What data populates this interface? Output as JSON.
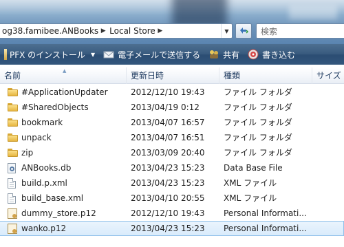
{
  "address": {
    "crumbs": [
      "og38.famibee.ANBooks",
      "Local Store"
    ],
    "separator": "▶",
    "dropdown_glyph": "▼"
  },
  "search": {
    "placeholder": "検索"
  },
  "toolbar": {
    "install_label": "PFX のインストール",
    "email_label": "電子メールで送信する",
    "share_label": "共有",
    "burn_label": "書き込む",
    "caret": "▼"
  },
  "columns": {
    "name": "名前",
    "date": "更新日時",
    "type": "種類",
    "size": "サイズ",
    "sort_glyph": "▲"
  },
  "files": [
    {
      "icon": "folder-icon",
      "name": "#ApplicationUpdater",
      "date": "2012/12/10 19:43",
      "type": "ファイル フォルダ"
    },
    {
      "icon": "folder-icon",
      "name": "#SharedObjects",
      "date": "2013/04/19 0:12",
      "type": "ファイル フォルダ"
    },
    {
      "icon": "folder-icon",
      "name": "bookmark",
      "date": "2013/04/07 16:57",
      "type": "ファイル フォルダ"
    },
    {
      "icon": "folder-icon",
      "name": "unpack",
      "date": "2013/04/07 16:51",
      "type": "ファイル フォルダ"
    },
    {
      "icon": "folder-icon",
      "name": "zip",
      "date": "2013/03/09 20:40",
      "type": "ファイル フォルダ"
    },
    {
      "icon": "database-file-icon",
      "name": "ANBooks.db",
      "date": "2013/04/23 15:23",
      "type": "Data Base File"
    },
    {
      "icon": "xml-file-icon",
      "name": "build.p.xml",
      "date": "2013/04/23 15:23",
      "type": "XML ファイル"
    },
    {
      "icon": "xml-file-icon",
      "name": "build_base.xml",
      "date": "2013/04/10 20:55",
      "type": "XML ファイル"
    },
    {
      "icon": "certificate-file-icon",
      "name": "dummy_store.p12",
      "date": "2012/12/10 19:43",
      "type": "Personal Informati..."
    },
    {
      "icon": "certificate-file-icon",
      "name": "wanko.p12",
      "date": "2013/04/23 15:23",
      "type": "Personal Informati...",
      "selected": true
    }
  ]
}
